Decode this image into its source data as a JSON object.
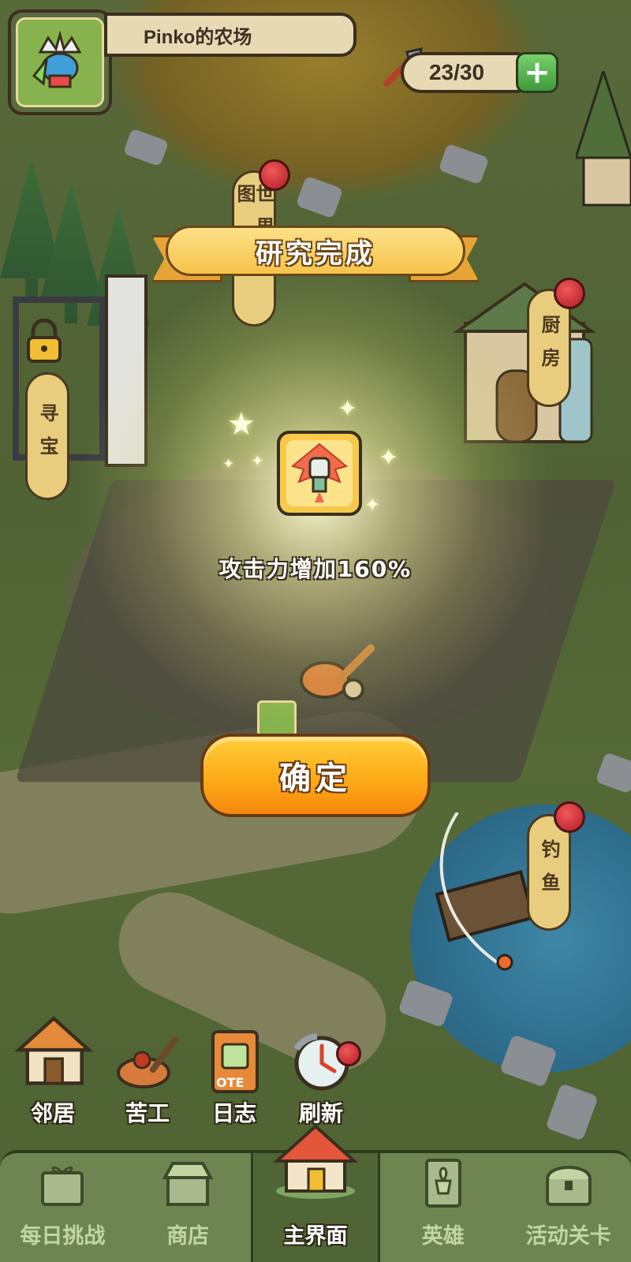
{
  "header": {
    "farm_name": "Pinko的农场",
    "energy": "23/30",
    "add_label": "+"
  },
  "buildings": {
    "world_map_label": "世界地图",
    "kitchen_label": "厨房",
    "treasure_label": "寻宝",
    "fishing_label": "钓鱼"
  },
  "popup": {
    "title": "研究完成",
    "reward_text": "攻击力增加160%",
    "reward_icon": "fist-rocket-icon",
    "confirm_label": "确定"
  },
  "quick_actions": [
    {
      "label": "邻居",
      "icon": "house-icon"
    },
    {
      "label": "苦工",
      "icon": "worker-icon",
      "badge": true
    },
    {
      "label": "日志",
      "icon": "notebook-icon"
    },
    {
      "label": "刷新",
      "icon": "refresh-clock-icon",
      "badge": true
    }
  ],
  "nav": [
    {
      "label": "每日挑战",
      "icon": "daily-challenge-icon"
    },
    {
      "label": "商店",
      "icon": "shop-icon"
    },
    {
      "label": "主界面",
      "icon": "home-icon",
      "active": true
    },
    {
      "label": "英雄",
      "icon": "hero-card-icon"
    },
    {
      "label": "活动关卡",
      "icon": "treasure-chest-icon"
    }
  ],
  "colors": {
    "banner": "#f6c34b",
    "confirm": "#fdab18",
    "nav_bg": "#6e8552",
    "badge": "#c9232e"
  }
}
